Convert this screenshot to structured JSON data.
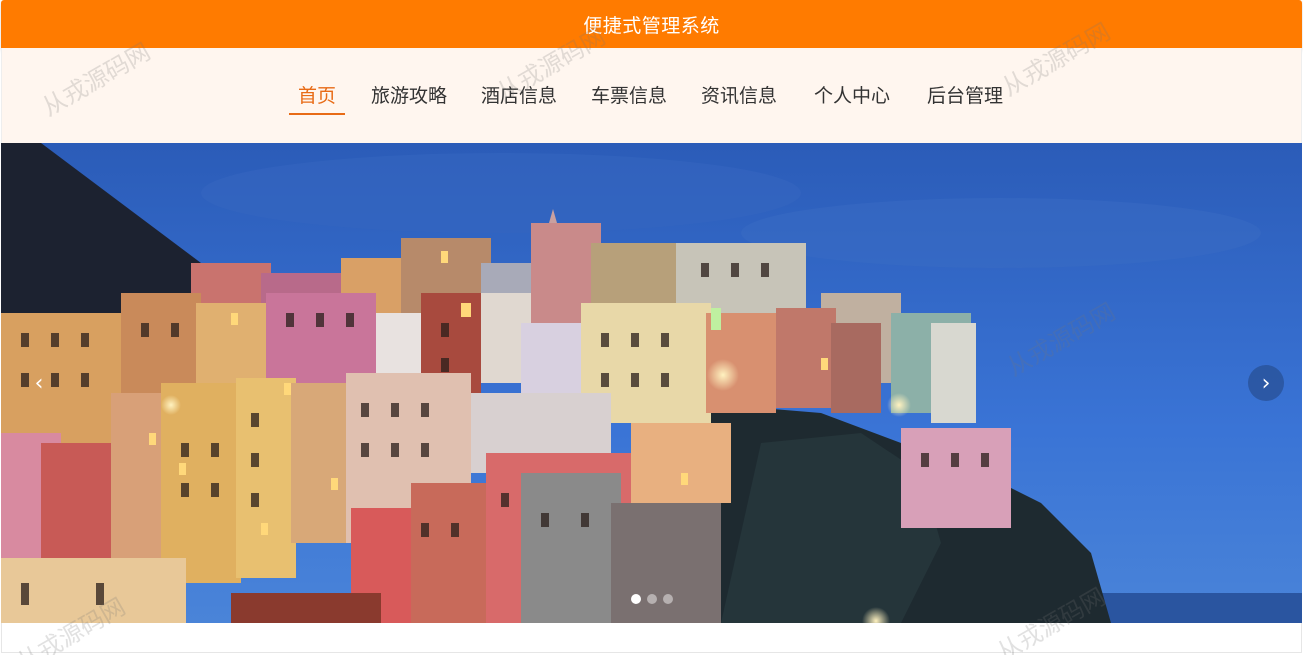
{
  "header": {
    "title": "便捷式管理系统"
  },
  "nav": {
    "items": [
      {
        "label": "首页",
        "active": true
      },
      {
        "label": "旅游攻略",
        "active": false
      },
      {
        "label": "酒店信息",
        "active": false
      },
      {
        "label": "车票信息",
        "active": false
      },
      {
        "label": "资讯信息",
        "active": false
      },
      {
        "label": "个人中心",
        "active": false
      },
      {
        "label": "后台管理",
        "active": false
      }
    ]
  },
  "carousel": {
    "prev_icon": "chevron-left-icon",
    "next_icon": "chevron-right-icon",
    "slide_count": 3,
    "active_index": 0
  },
  "watermark": {
    "text": "从戎源码网"
  },
  "colors": {
    "accent": "#ff7b00",
    "active_nav": "#e86b16",
    "nav_bg": "#fff6ef"
  }
}
